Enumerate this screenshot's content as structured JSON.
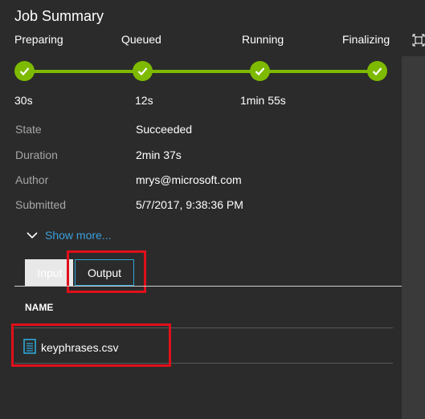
{
  "title": "Job Summary",
  "steps": [
    {
      "label": "Preparing",
      "time": "30s"
    },
    {
      "label": "Queued",
      "time": "12s"
    },
    {
      "label": "Running",
      "time": "1min 55s"
    },
    {
      "label": "Finalizing",
      "time": ""
    }
  ],
  "properties": [
    {
      "label": "State",
      "value": "Succeeded"
    },
    {
      "label": "Duration",
      "value": "2min 37s"
    },
    {
      "label": "Author",
      "value": "mrys@microsoft.com"
    },
    {
      "label": "Submitted",
      "value": "5/7/2017, 9:38:36 PM"
    }
  ],
  "show_more": {
    "label": "Show more...",
    "icon": "chevron-down-icon"
  },
  "tabs": [
    {
      "label": "Input",
      "selected": false
    },
    {
      "label": "Output",
      "selected": true
    }
  ],
  "files": {
    "column_header": "NAME",
    "items": [
      {
        "name": "keyphrases.csv",
        "icon": "file-icon"
      }
    ]
  },
  "colors": {
    "progress": "#7dba00",
    "link": "#3aa0dc",
    "highlight": "#e0101a",
    "tab_border": "#2ea7d8"
  }
}
